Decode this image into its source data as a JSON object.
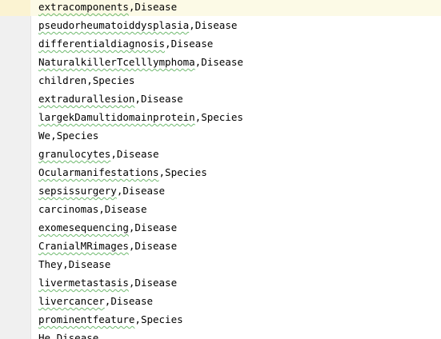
{
  "editor": {
    "lines": [
      {
        "entity": "extracomponents",
        "label": "Disease"
      },
      {
        "entity": "pseudorheumatoiddysplasia",
        "label": "Disease"
      },
      {
        "entity": "differentialdiagnosis",
        "label": "Disease"
      },
      {
        "entity": "NaturalkillerTcelllymphoma",
        "label": "Disease"
      },
      {
        "entity": "children",
        "label": "Species"
      },
      {
        "entity": "extradurallesion",
        "label": "Disease"
      },
      {
        "entity": "largekDamultidomainprotein",
        "label": "Species"
      },
      {
        "entity": "We",
        "label": "Species"
      },
      {
        "entity": "granulocytes",
        "label": "Disease"
      },
      {
        "entity": "Ocularmanifestations",
        "label": "Species"
      },
      {
        "entity": "sepsissurgery",
        "label": "Disease"
      },
      {
        "entity": "carcinomas",
        "label": "Disease"
      },
      {
        "entity": "exomesequencing",
        "label": "Disease"
      },
      {
        "entity": "CranialMRimages",
        "label": "Disease"
      },
      {
        "entity": "They",
        "label": "Disease"
      },
      {
        "entity": "livermetastasis",
        "label": "Disease"
      },
      {
        "entity": "livercancer",
        "label": "Disease"
      },
      {
        "entity": "prominentfeature",
        "label": "Species"
      },
      {
        "entity": "He",
        "label": "Disease"
      }
    ],
    "separator": ","
  }
}
